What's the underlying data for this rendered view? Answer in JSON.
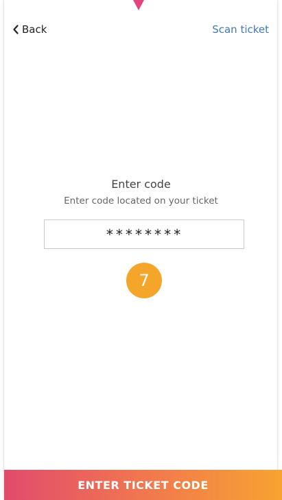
{
  "nav": {
    "back_label": "Back",
    "scan_label": "Scan ticket"
  },
  "main": {
    "title": "Enter code",
    "subtitle": "Enter code located on your ticket",
    "code_value": "********",
    "step_number": "7"
  },
  "cta": {
    "label": "ENTER TICKET CODE"
  },
  "colors": {
    "accent_link": "#3f78b5",
    "badge": "#f5a52a",
    "gradient_start": "#e14b6c",
    "gradient_end": "#f7a331",
    "pointer": "#e5427e"
  },
  "icons": {
    "back": "chevron-left-icon",
    "pointer": "triangle-pointer-icon"
  }
}
